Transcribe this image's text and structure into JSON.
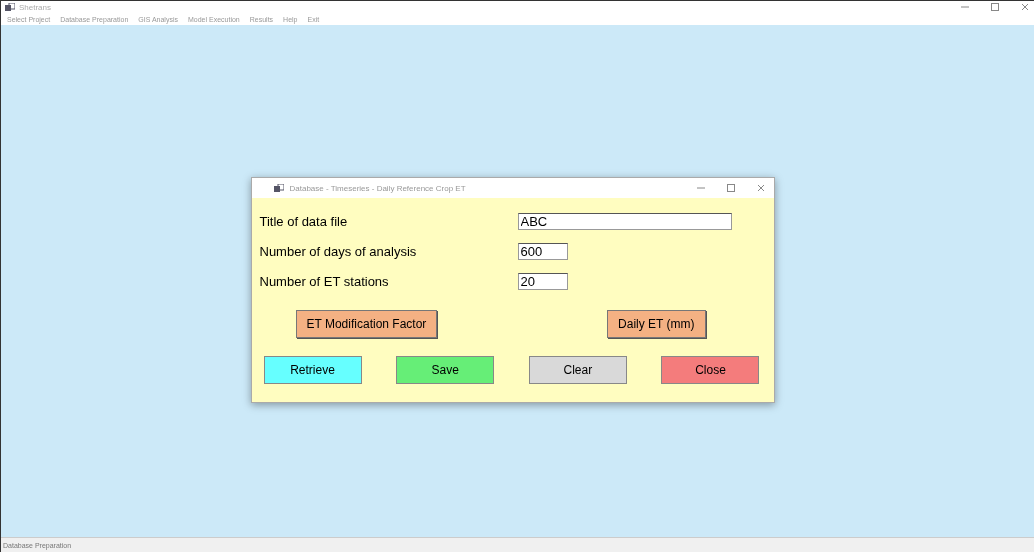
{
  "window": {
    "title": "Shetrans"
  },
  "menu": [
    "Select Project",
    "Database Preparation",
    "GIS Analysis",
    "Model Execution",
    "Results",
    "Help",
    "Exit"
  ],
  "dialog": {
    "title": "Database - Timeseries - Daily Reference Crop ET",
    "fields": [
      {
        "label": "Title of data file",
        "value": "ABC",
        "kind": "wide"
      },
      {
        "label": "Number of days of analysis",
        "value": "600",
        "kind": "short"
      },
      {
        "label": "Number of ET stations",
        "value": "20",
        "kind": "short"
      }
    ],
    "actions": [
      {
        "label": "ET Modification Factor",
        "color": "#f4b183"
      },
      {
        "label": "Daily ET (mm)",
        "color": "#f4b183"
      }
    ],
    "buttons": [
      {
        "label": "Retrieve",
        "color": "#66ffff"
      },
      {
        "label": "Save",
        "color": "#66ee77"
      },
      {
        "label": "Clear",
        "color": "#d9d9d9"
      },
      {
        "label": "Close",
        "color": "#f47c7c"
      }
    ]
  },
  "status_bar": "Database Preparation"
}
